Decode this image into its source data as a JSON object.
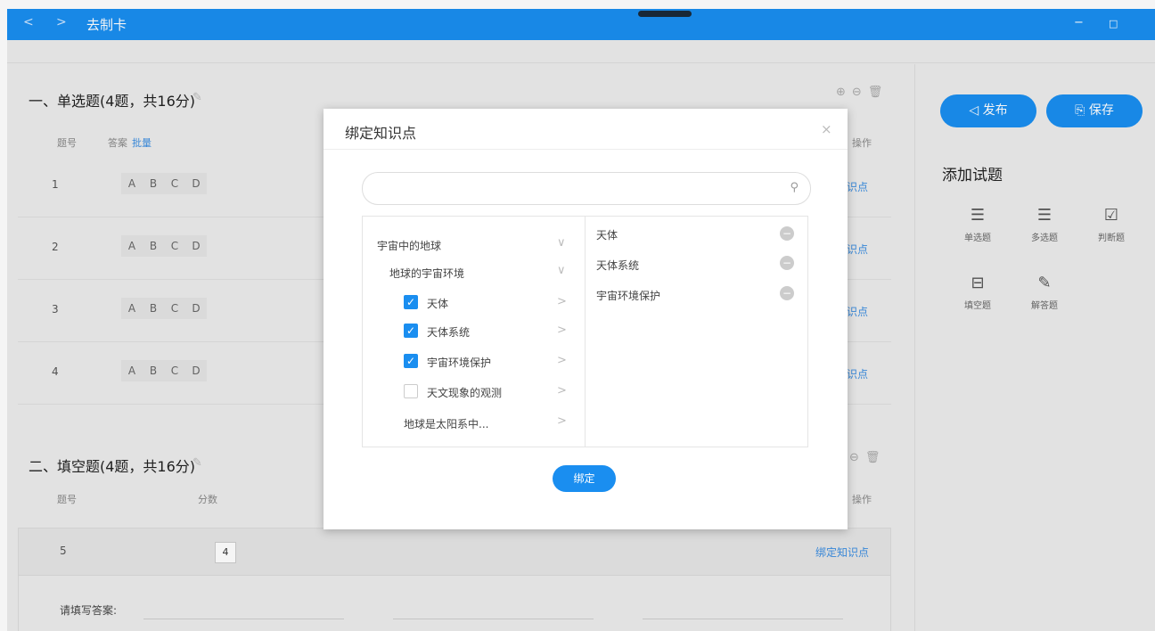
{
  "titlebar": {
    "back": "<",
    "forward": ">",
    "title": "去制卡",
    "minimize": "−",
    "maximize": "□"
  },
  "section1": {
    "title": "一、单选题(4题，共16分)",
    "headers": {
      "num": "题号",
      "answer": "答案",
      "batch": "批量",
      "ops": "操作"
    },
    "options": [
      "A",
      "B",
      "C",
      "D"
    ],
    "rows": [
      {
        "num": "1",
        "link": "识点"
      },
      {
        "num": "2",
        "link": "识点"
      },
      {
        "num": "3",
        "link": "识点"
      },
      {
        "num": "4",
        "link": "识点"
      }
    ]
  },
  "section2": {
    "title": "二、填空题(4题，共16分)",
    "headers": {
      "num": "题号",
      "score": "分数",
      "ops": "操作"
    },
    "row": {
      "num": "5",
      "score": "4",
      "link": "绑定知识点"
    },
    "answer_label": "请填写答案:"
  },
  "right": {
    "publish": "发布",
    "save": "保存",
    "add_title": "添加试题",
    "types": [
      {
        "label": "单选题",
        "icon": "single-choice-icon"
      },
      {
        "label": "多选题",
        "icon": "multi-choice-icon"
      },
      {
        "label": "判断题",
        "icon": "judge-icon"
      },
      {
        "label": "填空题",
        "icon": "fill-blank-icon"
      },
      {
        "label": "解答题",
        "icon": "answer-icon"
      }
    ]
  },
  "modal": {
    "title": "绑定知识点",
    "close": "×",
    "search_placeholder": "",
    "tree": {
      "level1": "宇宙中的地球",
      "level2": "地球的宇宙环境",
      "items": [
        {
          "label": "天体",
          "checked": true
        },
        {
          "label": "天体系统",
          "checked": true
        },
        {
          "label": "宇宙环境保护",
          "checked": true
        },
        {
          "label": "天文现象的观测",
          "checked": false
        }
      ],
      "more": "地球是太阳系中..."
    },
    "selected": [
      "天体",
      "天体系统",
      "宇宙环境保护"
    ],
    "bind_button": "绑定"
  }
}
